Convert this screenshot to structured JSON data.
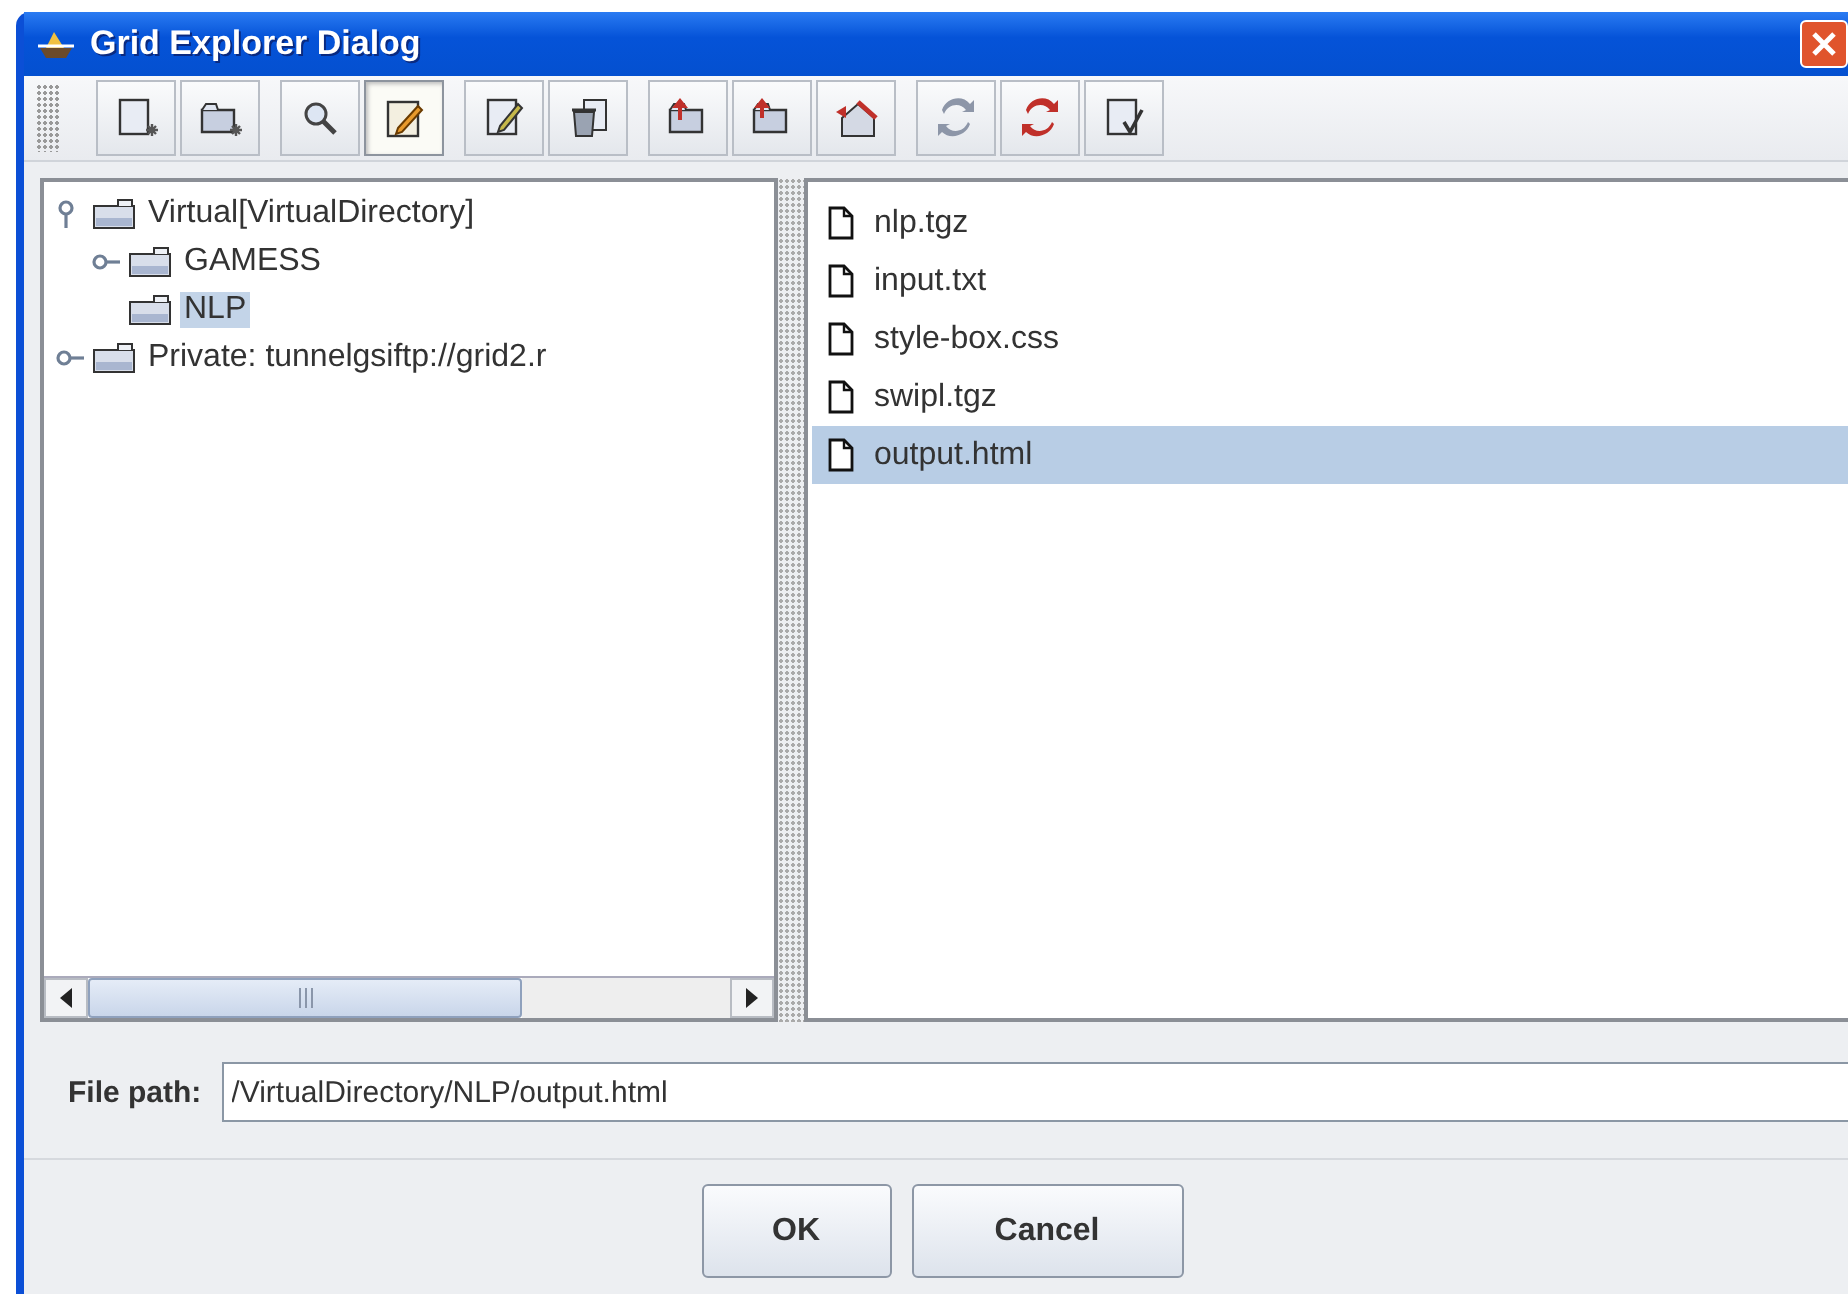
{
  "window": {
    "title": "Grid Explorer Dialog"
  },
  "toolbar": {
    "groups": [
      [
        {
          "kind": "new-file",
          "selected": false
        },
        {
          "kind": "new-folder",
          "selected": false
        }
      ],
      [
        {
          "kind": "search",
          "selected": false
        },
        {
          "kind": "edit",
          "selected": true
        }
      ],
      [
        {
          "kind": "rename",
          "selected": false
        },
        {
          "kind": "delete",
          "selected": false
        }
      ],
      [
        {
          "kind": "up-file",
          "selected": false
        },
        {
          "kind": "up-folder",
          "selected": false
        },
        {
          "kind": "home",
          "selected": false
        }
      ],
      [
        {
          "kind": "refresh",
          "selected": false
        },
        {
          "kind": "refresh-red",
          "selected": false
        },
        {
          "kind": "properties",
          "selected": false
        }
      ]
    ]
  },
  "tree": {
    "items": [
      {
        "label": "Virtual[VirtualDirectory]",
        "expanded": true,
        "selected": false,
        "children": [
          {
            "label": "GAMESS",
            "expanded": false,
            "selected": false
          },
          {
            "label": "NLP",
            "selected": true
          }
        ]
      },
      {
        "label": "Private: tunnelgsiftp://grid2.r",
        "expanded": false,
        "selected": false
      }
    ]
  },
  "files": [
    {
      "name": "nlp.tgz",
      "selected": false
    },
    {
      "name": "input.txt",
      "selected": false
    },
    {
      "name": "style-box.css",
      "selected": false
    },
    {
      "name": "swipl.tgz",
      "selected": false
    },
    {
      "name": "output.html",
      "selected": true
    }
  ],
  "file_path": {
    "label": "File path:",
    "value": "/VirtualDirectory/NLP/output.html"
  },
  "buttons": [
    "OK",
    "Cancel"
  ]
}
